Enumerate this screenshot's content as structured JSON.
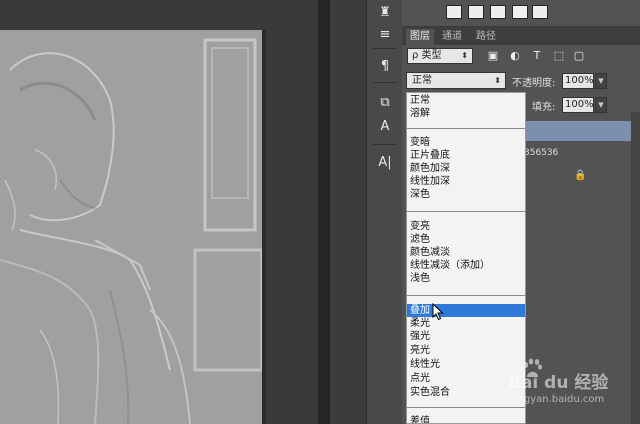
{
  "panel": {
    "tabs": [
      "图层",
      "通道",
      "路径"
    ],
    "filter_kind": "ρ 类型",
    "blend_mode": "正常",
    "opacity_label": "不透明度:",
    "opacity_value": "100%",
    "fill_label": "填充:",
    "fill_value": "100%",
    "layer_name_fragment": "356536"
  },
  "blend_options": {
    "group1": [
      "正常",
      "溶解"
    ],
    "group2": [
      "变暗",
      "正片叠底",
      "颜色加深",
      "线性加深",
      "深色"
    ],
    "group3": [
      "变亮",
      "滤色",
      "颜色减淡",
      "线性减淡（添加）",
      "浅色"
    ],
    "group4": [
      "叠加",
      "柔光",
      "强光",
      "亮光",
      "线性光",
      "点光",
      "实色混合"
    ],
    "group5": [
      "差值"
    ],
    "selected": "叠加"
  },
  "watermark": {
    "logo": "Bai du 经验",
    "url": "jingyan.baidu.com"
  },
  "colors": {
    "highlight": "#2f7ad8",
    "panel_bg": "#535353"
  }
}
